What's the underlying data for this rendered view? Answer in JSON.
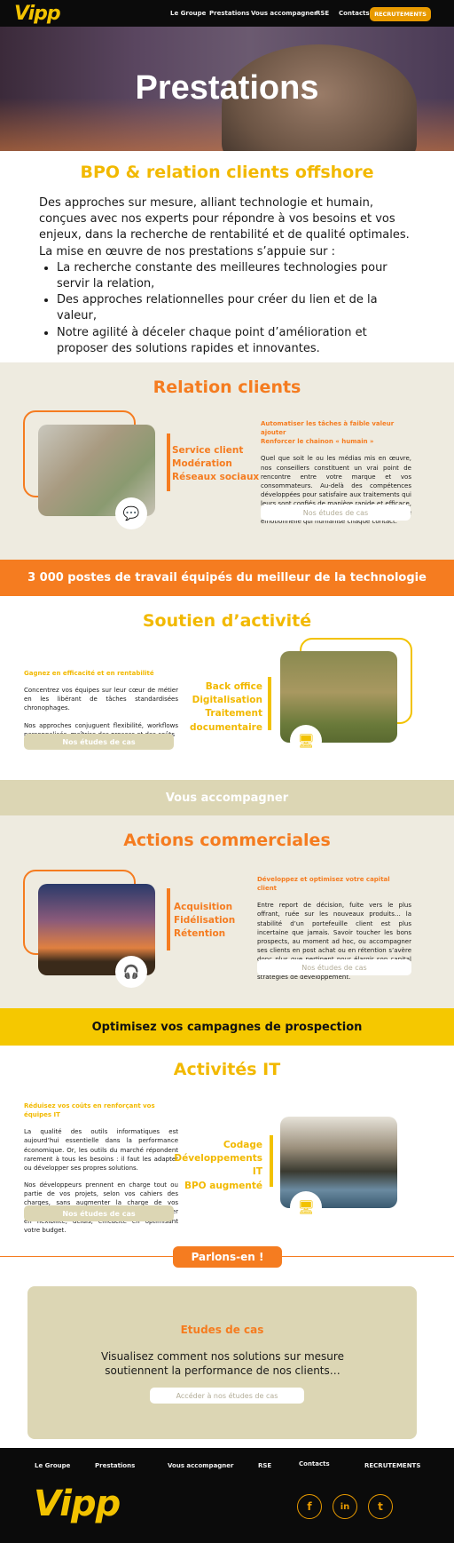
{
  "header": {
    "logo": "Vipp",
    "nav": [
      "Le Groupe",
      "Prestations",
      "Vous accompagner",
      "RSE",
      "Contacts"
    ],
    "cta": "RECRUTEMENTS"
  },
  "hero": {
    "title": "Prestations"
  },
  "bpo": {
    "title": "BPO & relation clients offshore",
    "intro": "Des approches sur mesure, alliant technologie et humain, conçues avec nos experts pour répondre à vos besoins et vos enjeux, dans la recherche de rentabilité et de qualité optimales.",
    "lead": "La mise en œuvre de nos prestations s’appuie sur :",
    "bullets": [
      "La recherche constante des meilleures technologies pour servir la relation,",
      "Des approches relationnelles pour créer du lien et de la valeur,",
      "Notre agilité à déceler chaque point d’amélioration et proposer des solutions rapides et innovantes."
    ]
  },
  "relation": {
    "title": "Relation clients",
    "labels": [
      "Service client",
      "Modération",
      "Réseaux sociaux"
    ],
    "subtitle": "Automatiser les tâches à faible valeur ajouter",
    "subtitle2": "Renforcer le chainon « humain »",
    "text": "Quel que soit le ou les médias mis en œuvre, nos conseillers constituent un vrai point de rencontre entre votre marque et vos consommateurs. Au-delà des compétences développées pour satisfaire aux traitements qui leurs sont confiés de manière rapide et efficace, ils sont formés à cultiver l’intelligence émotionnelle qui humanise chaque contact.",
    "button": "Nos études de cas"
  },
  "banner1": "3 000 postes de travail équipés du meilleur de la technologie",
  "soutien": {
    "title": "Soutien d’activité",
    "subtitle": "Gagnez en efficacité et en rentabilité",
    "text1": "Concentrez vos équipes sur leur cœur de métier en les libérant de tâches standardisées chronophages.",
    "text2": "Nos approches conjuguent flexibilité, workflows personnalisés, maîtrise des process et des coûts",
    "labels": [
      "Back office",
      "Digitalisation",
      "Traitement",
      "documentaire"
    ],
    "button": "Nos études de cas"
  },
  "banner2": "Vous accompagner",
  "actions": {
    "title": "Actions commerciales",
    "labels": [
      "Acquisition",
      "Fidélisation",
      "Rétention"
    ],
    "subtitle": "Développez et optimisez votre capital client",
    "text": "Entre report de décision, fuite vers le plus offrant, ruée sur les nouveaux produits… la stabilité d’un portefeuille client est plus incertaine que jamais. Savoir toucher les bons prospects, au moment ad hoc, ou accompagner ses clients en post achat ou en rétention s’avère donc plus que pertinent pour élargir son capital client. Nos équipes soutiennent et renforcent vos stratégies de développement.",
    "button": "Nos études de cas"
  },
  "banner3": "Optimisez vos campagnes de prospection",
  "it": {
    "title": "Activités IT",
    "subtitle": "Réduisez vos coûts en renforçant vos équipes IT",
    "text1": "La qualité des outils informatiques est aujourd’hui essentielle dans la performance économique. Or, les outils du marché répondent rarement à tous les besoins : il faut les adapter ou développer ses propres solutions.",
    "text2": "Nos développeurs prennent en charge tout ou partie de vos projets, selon vos cahiers des charges, sans augmenter la charge de vos équipes. Cette solution vous permet de gagner en flexibilité, délais, efficacité en optimisant votre budget.",
    "labels": [
      "Codage",
      "Développements IT",
      "BPO augmenté"
    ],
    "button": "Nos études de cas"
  },
  "talk": "Parlons-en !",
  "cases": {
    "title": "Etudes de cas",
    "text": "Visualisez comment nos solutions sur mesure soutiennent la performance de nos clients…",
    "button": "Accéder à nos études de cas"
  },
  "footer": {
    "nav": [
      "Le Groupe",
      "Prestations",
      "Vous accompagner",
      "RSE",
      "Contacts",
      "RECRUTEMENTS"
    ],
    "logo": "Vipp",
    "social": [
      "f",
      "in",
      "t"
    ]
  }
}
